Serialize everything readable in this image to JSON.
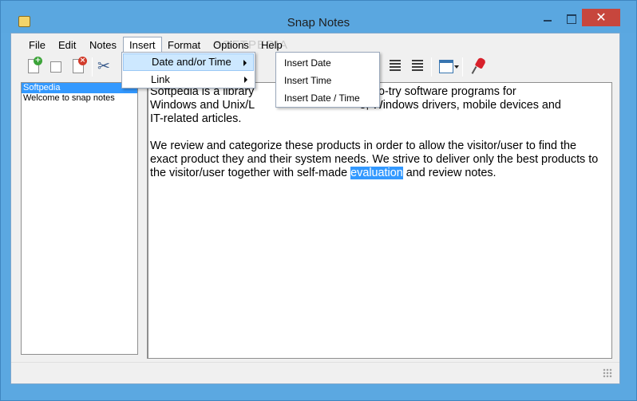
{
  "window": {
    "title": "Snap Notes",
    "close_glyph": "✕"
  },
  "menubar": {
    "items": [
      "File",
      "Edit",
      "Notes",
      "Insert",
      "Format",
      "Options",
      "Help"
    ],
    "watermark": "SOFTPEDIA"
  },
  "toolbar": {
    "icons": [
      "new-note-icon",
      "save-note-icon",
      "delete-note-icon",
      "cut-icon",
      "align-center-icon",
      "align-right-icon",
      "calendar-icon",
      "pin-icon"
    ]
  },
  "notes": {
    "items": [
      {
        "label": "Softpedia",
        "selected": true
      },
      {
        "label": "Welcome to snap notes",
        "selected": false
      }
    ]
  },
  "editor": {
    "line1_visible": "Softpedia is a library",
    "line1_rest": " free-to-try software programs for",
    "line2_visible": "Windows and Unix/L",
    "line2_rest": "e, Windows drivers, mobile devices and",
    "line3": "IT-related articles.",
    "para2_line1": "We review and categorize these products in order to allow the visitor/user to find the",
    "para2_line2": "exact product they and their system needs. We strive to deliver only the best products to",
    "para2_line3_before": "the visitor/user together with self-made ",
    "para2_line3_highlight": "evaluation",
    "para2_line3_after": " and review notes."
  },
  "insert_menu": {
    "items": [
      "Date and/or Time",
      "Link"
    ],
    "active_index": 0
  },
  "date_submenu": {
    "items": [
      "Insert Date",
      "Insert Time",
      "Insert Date / Time"
    ]
  },
  "colors": {
    "title_bar": "#5aa7e0",
    "close_button": "#c7463d",
    "selection": "#3399ff",
    "menu_hover": "#cde8ff"
  }
}
